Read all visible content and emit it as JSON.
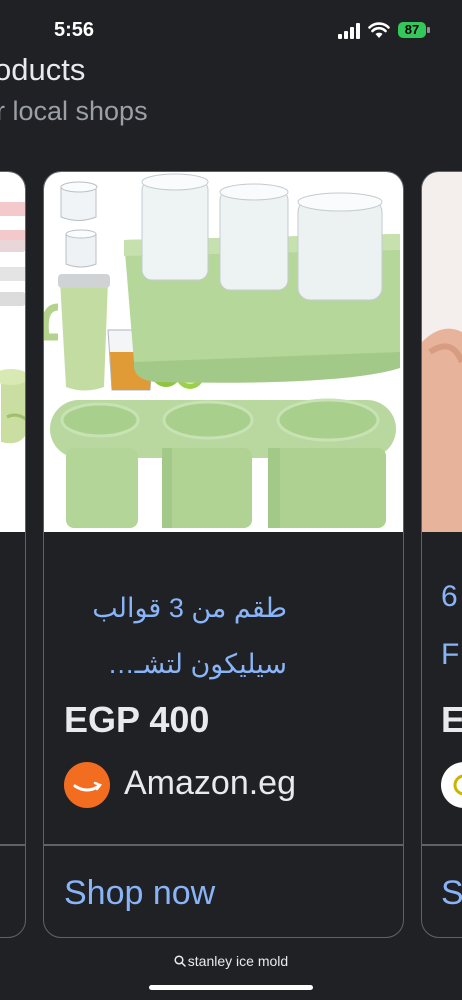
{
  "status_bar": {
    "time": "5:56",
    "battery": "87"
  },
  "section": {
    "title": "oducts",
    "subtitle": "r local shops"
  },
  "main_card": {
    "title": "طقم من 3 قوالب سيليكون لتشـ…",
    "price": "EGP 400",
    "store": "Amazon.eg",
    "shop_label": "Shop now"
  },
  "right_card": {
    "title_line1": "6",
    "title_line2": "F",
    "price": "E",
    "shop_label": "S"
  },
  "search": {
    "query": "stanley ice mold"
  },
  "colors": {
    "background": "#202124",
    "link": "#8ab4f8",
    "amazon": "#f36d21",
    "battery": "#34c759"
  }
}
